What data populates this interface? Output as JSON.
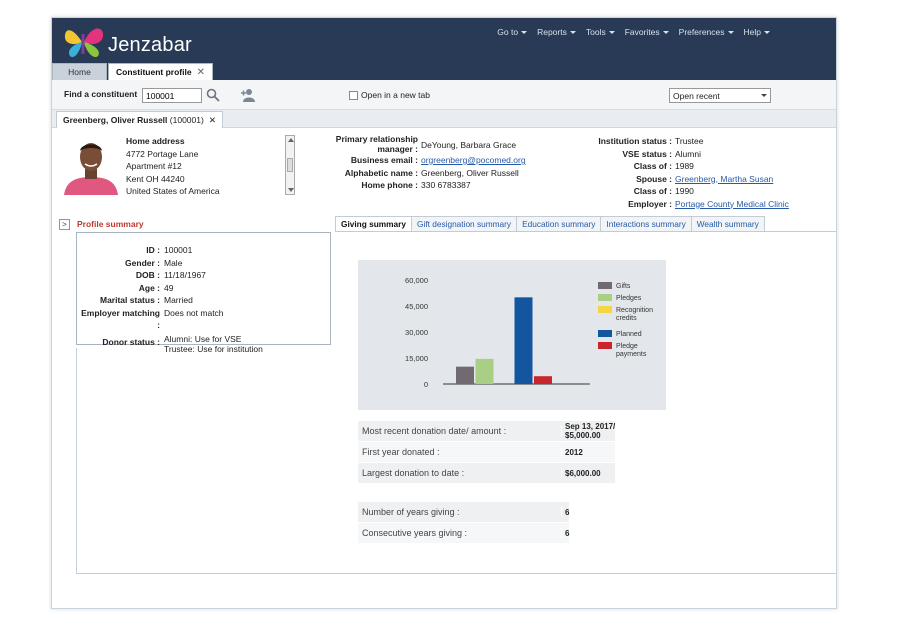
{
  "brand": {
    "name": "Jenzabar"
  },
  "topnav": [
    {
      "label": "Go to"
    },
    {
      "label": "Reports"
    },
    {
      "label": "Tools"
    },
    {
      "label": "Favorites"
    },
    {
      "label": "Preferences"
    },
    {
      "label": "Help"
    }
  ],
  "tabs": {
    "home": "Home",
    "active": "Constituent profile"
  },
  "findbar": {
    "label": "Find a constituent",
    "value": "100001",
    "newtab_label": "Open in a new tab",
    "open_recent": "Open recent"
  },
  "record_tab": {
    "name": "Greenberg, Oliver Russell",
    "id": "(100001)"
  },
  "address": {
    "label": "Home address",
    "lines": [
      "4772 Portage Lane",
      "Apartment #12",
      "Kent OH 44240",
      "United States of America"
    ]
  },
  "contact": {
    "rel_mgr_label": "Primary relationship",
    "rel_mgr_label2": "manager :",
    "rel_mgr": "DeYoung, Barbara Grace",
    "email_label": "Business email :",
    "email": "orgreenberg@pocomed.org",
    "alpha_label": "Alphabetic name :",
    "alpha": "Greenberg, Oliver Russell",
    "phone_label": "Home phone :",
    "phone": "330 6783387"
  },
  "status": {
    "inst_label": "Institution status :",
    "inst": "Trustee",
    "vse_label": "VSE status :",
    "vse": "Alumni",
    "class1_label": "Class of :",
    "class1": "1989",
    "spouse_label": "Spouse :",
    "spouse": "Greenberg, Martha Susan",
    "class2_label": "Class of :",
    "class2": "1990",
    "employer_label": "Employer :",
    "employer": "Portage County Medical Clinic"
  },
  "profile": {
    "title": "Profile summary",
    "rows": [
      {
        "k": "ID :",
        "v": "100001"
      },
      {
        "k": "Gender :",
        "v": "Male"
      },
      {
        "k": "DOB :",
        "v": "11/18/1967"
      },
      {
        "k": "Age :",
        "v": "49"
      },
      {
        "k": "Marital status :",
        "v": "Married"
      },
      {
        "k": "Employer matching :",
        "v": "Does not match"
      },
      {
        "k": "Donor status :",
        "v": "Alumni: Use for VSE\nTrustee: Use for institution"
      }
    ]
  },
  "giving_tabs": [
    {
      "label": "Giving summary"
    },
    {
      "label": "Gift designation summary"
    },
    {
      "label": "Education summary"
    },
    {
      "label": "Interactions summary"
    },
    {
      "label": "Wealth summary"
    }
  ],
  "chart_data": {
    "type": "bar",
    "categories": [
      "Gifts",
      "Pledges",
      "Recognition credits",
      "Planned",
      "Pledge payments"
    ],
    "values": [
      10000,
      14500,
      0,
      50000,
      4500
    ],
    "colors": [
      "#716a73",
      "#a9ce86",
      "#f4d542",
      "#11569e",
      "#c9252c"
    ],
    "yticks": [
      0,
      15000,
      30000,
      45000,
      60000
    ],
    "ytick_labels": [
      "0",
      "15,000",
      "30,000",
      "45,000",
      "60,000"
    ],
    "ylim": [
      0,
      60000
    ],
    "legend": [
      "Gifts",
      "Pledges",
      "Recognition credits",
      "Planned",
      "Pledge payments"
    ],
    "legend_position": "right",
    "title": "",
    "xlabel": "",
    "ylabel": ""
  },
  "stats1": [
    {
      "k": "Most recent donation date/ amount :",
      "v": "Sep 13, 2017/\n$5,000.00"
    },
    {
      "k": "First year donated :",
      "v": "2012"
    },
    {
      "k": "Largest donation to date :",
      "v": "$6,000.00"
    }
  ],
  "stats2": [
    {
      "k": "Number of years giving :",
      "v": "6"
    },
    {
      "k": "Consecutive years giving :",
      "v": "6"
    }
  ]
}
